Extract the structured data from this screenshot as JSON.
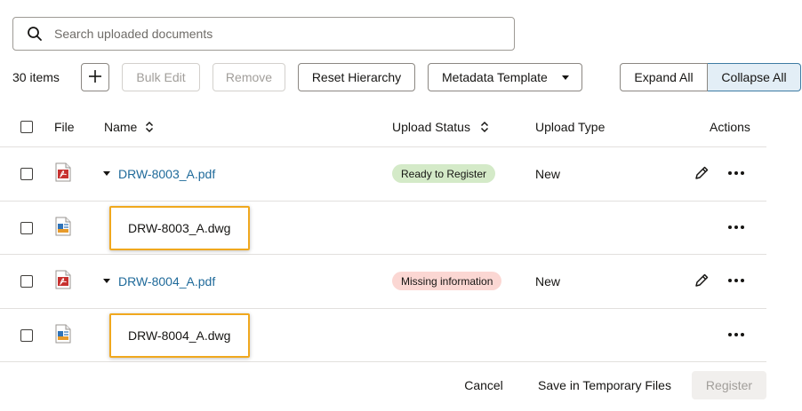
{
  "search": {
    "placeholder": "Search uploaded documents",
    "value": ""
  },
  "toolbar": {
    "count": "30 items",
    "add_label": "+",
    "bulk_edit_label": "Bulk Edit",
    "remove_label": "Remove",
    "reset_hierarchy_label": "Reset Hierarchy",
    "metadata_template_label": "Metadata Template",
    "expand_all_label": "Expand All",
    "collapse_all_label": "Collapse All"
  },
  "table": {
    "headers": {
      "file": "File",
      "name": "Name",
      "upload_status": "Upload Status",
      "upload_type": "Upload Type",
      "actions": "Actions"
    },
    "rows": [
      {
        "file_icon": "pdf-file-icon",
        "name": "DRW-8003_A.pdf",
        "status": "Ready to Register",
        "upload_type": "New"
      },
      {
        "file_icon": "dwg-file-icon",
        "name": "DRW-8003_A.dwg"
      },
      {
        "file_icon": "pdf-file-icon",
        "name": "DRW-8004_A.pdf",
        "status": "Missing information",
        "upload_type": "New"
      },
      {
        "file_icon": "dwg-file-icon",
        "name": "DRW-8004_A.dwg"
      }
    ]
  },
  "footer": {
    "cancel_label": "Cancel",
    "save_label": "Save in Temporary Files",
    "register_label": "Register"
  },
  "colors": {
    "link": "#1f6a9a",
    "ready_badge": "#d4eac8",
    "missing_badge": "#fbd7d3",
    "highlight": "#f0a81e",
    "selected_toggle": "#e3eef6"
  }
}
